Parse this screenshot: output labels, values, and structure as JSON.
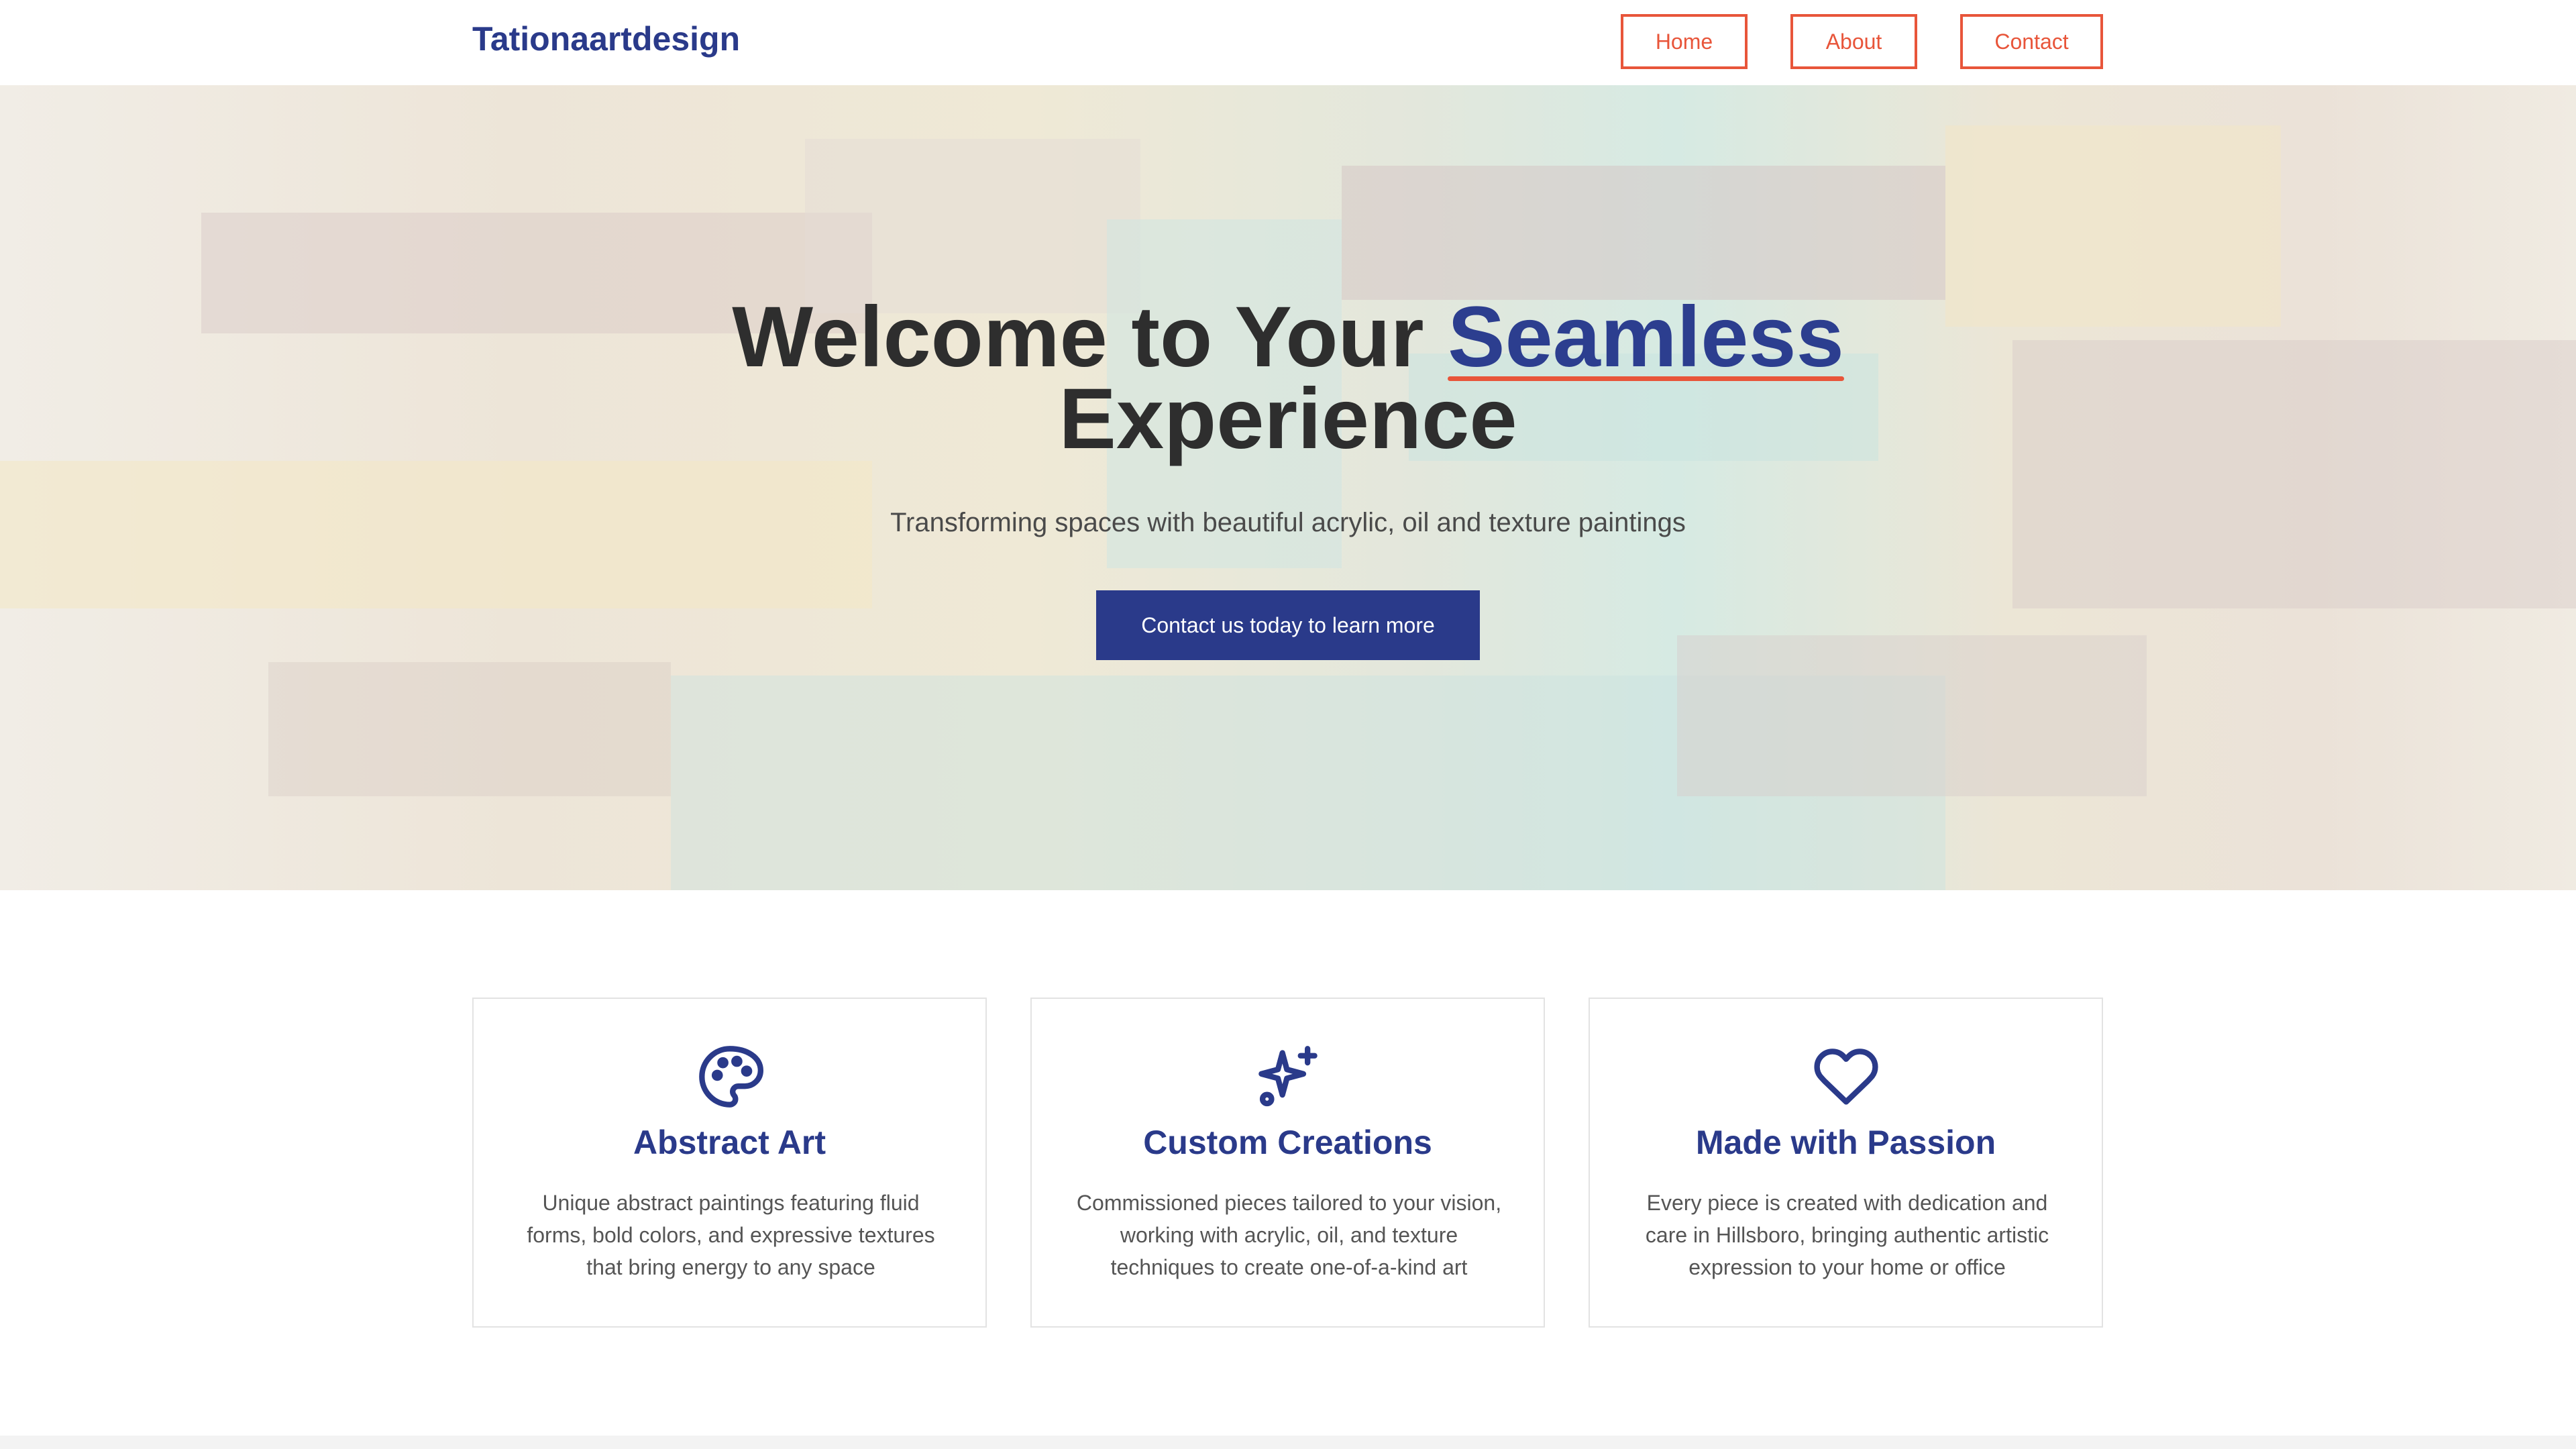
{
  "brand": {
    "name": "Tationaartdesign"
  },
  "nav": {
    "items": [
      "Home",
      "About",
      "Contact"
    ]
  },
  "hero": {
    "title_part1": "Welcome to Your ",
    "title_accent": "Seamless",
    "title_part2": "Experience",
    "subtitle": "Transforming spaces with beautiful acrylic, oil and texture paintings",
    "cta_label": "Contact us today to learn more"
  },
  "features": [
    {
      "icon": "palette-icon",
      "title": "Abstract Art",
      "text": "Unique abstract paintings featuring fluid forms, bold colors, and expressive textures that bring energy to any space"
    },
    {
      "icon": "sparkles-icon",
      "title": "Custom Creations",
      "text": "Commissioned pieces tailored to your vision, working with acrylic, oil, and texture techniques to create one-of-a-kind art"
    },
    {
      "icon": "heart-icon",
      "title": "Made with Passion",
      "text": "Every piece is created with dedication and care in Hillsboro, bringing authentic artistic expression to your home or office"
    }
  ],
  "colors": {
    "brand": "#2a3a8a",
    "accent": "#e8553a",
    "text": "#2e2e2e"
  }
}
